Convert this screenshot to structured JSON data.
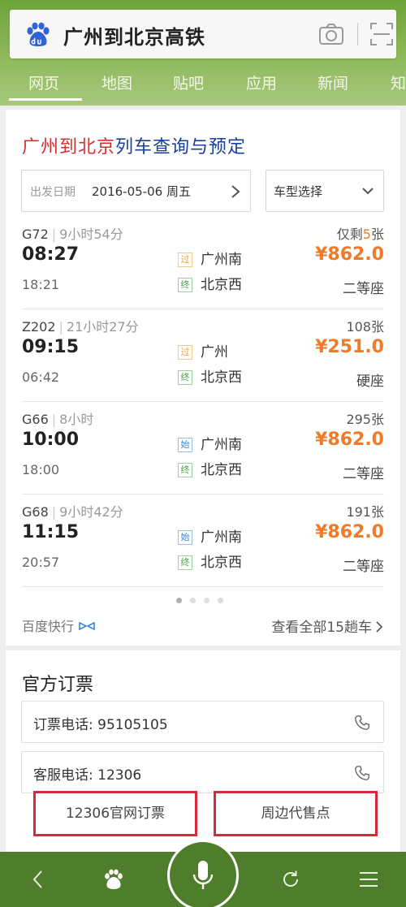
{
  "search": {
    "query": "广州到北京高铁"
  },
  "tabs": [
    "网页",
    "地图",
    "贴吧",
    "应用",
    "新闻",
    "知"
  ],
  "card": {
    "title_red": "广州到北京",
    "title_blue": "列车查询与预定",
    "date_label": "出发日期",
    "date_value": "2016-05-06 周五",
    "train_type": "车型选择"
  },
  "trains": [
    {
      "no": "G72",
      "duration": "9小时54分",
      "depart": "08:27",
      "arrive": "18:21",
      "from_tag": "过",
      "from": "广州南",
      "to_tag": "终",
      "to": "北京西",
      "tickets_prefix": "仅剩",
      "tickets_num": "5",
      "tickets_suffix": "张",
      "price": "¥862.0",
      "seat": "二等座"
    },
    {
      "no": "Z202",
      "duration": "21小时27分",
      "depart": "09:15",
      "arrive": "06:42",
      "from_tag": "过",
      "from": "广州",
      "to_tag": "终",
      "to": "北京西",
      "tickets_prefix": "",
      "tickets_num": "108",
      "tickets_suffix": "张",
      "price": "¥251.0",
      "seat": "硬座"
    },
    {
      "no": "G66",
      "duration": "8小时",
      "depart": "10:00",
      "arrive": "18:00",
      "from_tag": "始",
      "from": "广州南",
      "to_tag": "终",
      "to": "北京西",
      "tickets_prefix": "",
      "tickets_num": "295",
      "tickets_suffix": "张",
      "price": "¥862.0",
      "seat": "二等座"
    },
    {
      "no": "G68",
      "duration": "9小时42分",
      "depart": "11:15",
      "arrive": "20:57",
      "from_tag": "始",
      "from": "广州南",
      "to_tag": "终",
      "to": "北京西",
      "tickets_prefix": "",
      "tickets_num": "191",
      "tickets_suffix": "张",
      "price": "¥862.0",
      "seat": "二等座"
    }
  ],
  "footer": {
    "fast_label": "百度快行",
    "view_all": "查看全部15趟车"
  },
  "official": {
    "title": "官方订票",
    "booking_phone": "订票电话:  95105105",
    "service_phone": "客服电话:  12306",
    "btn_official": "12306官网订票",
    "btn_nearby": "周边代售点"
  },
  "colors": {
    "accent_green": "#6ea33a",
    "bar_green": "#4e7e2b",
    "price_orange": "#f07a28",
    "title_red": "#d32f2f",
    "title_blue": "#1a3e9b"
  }
}
